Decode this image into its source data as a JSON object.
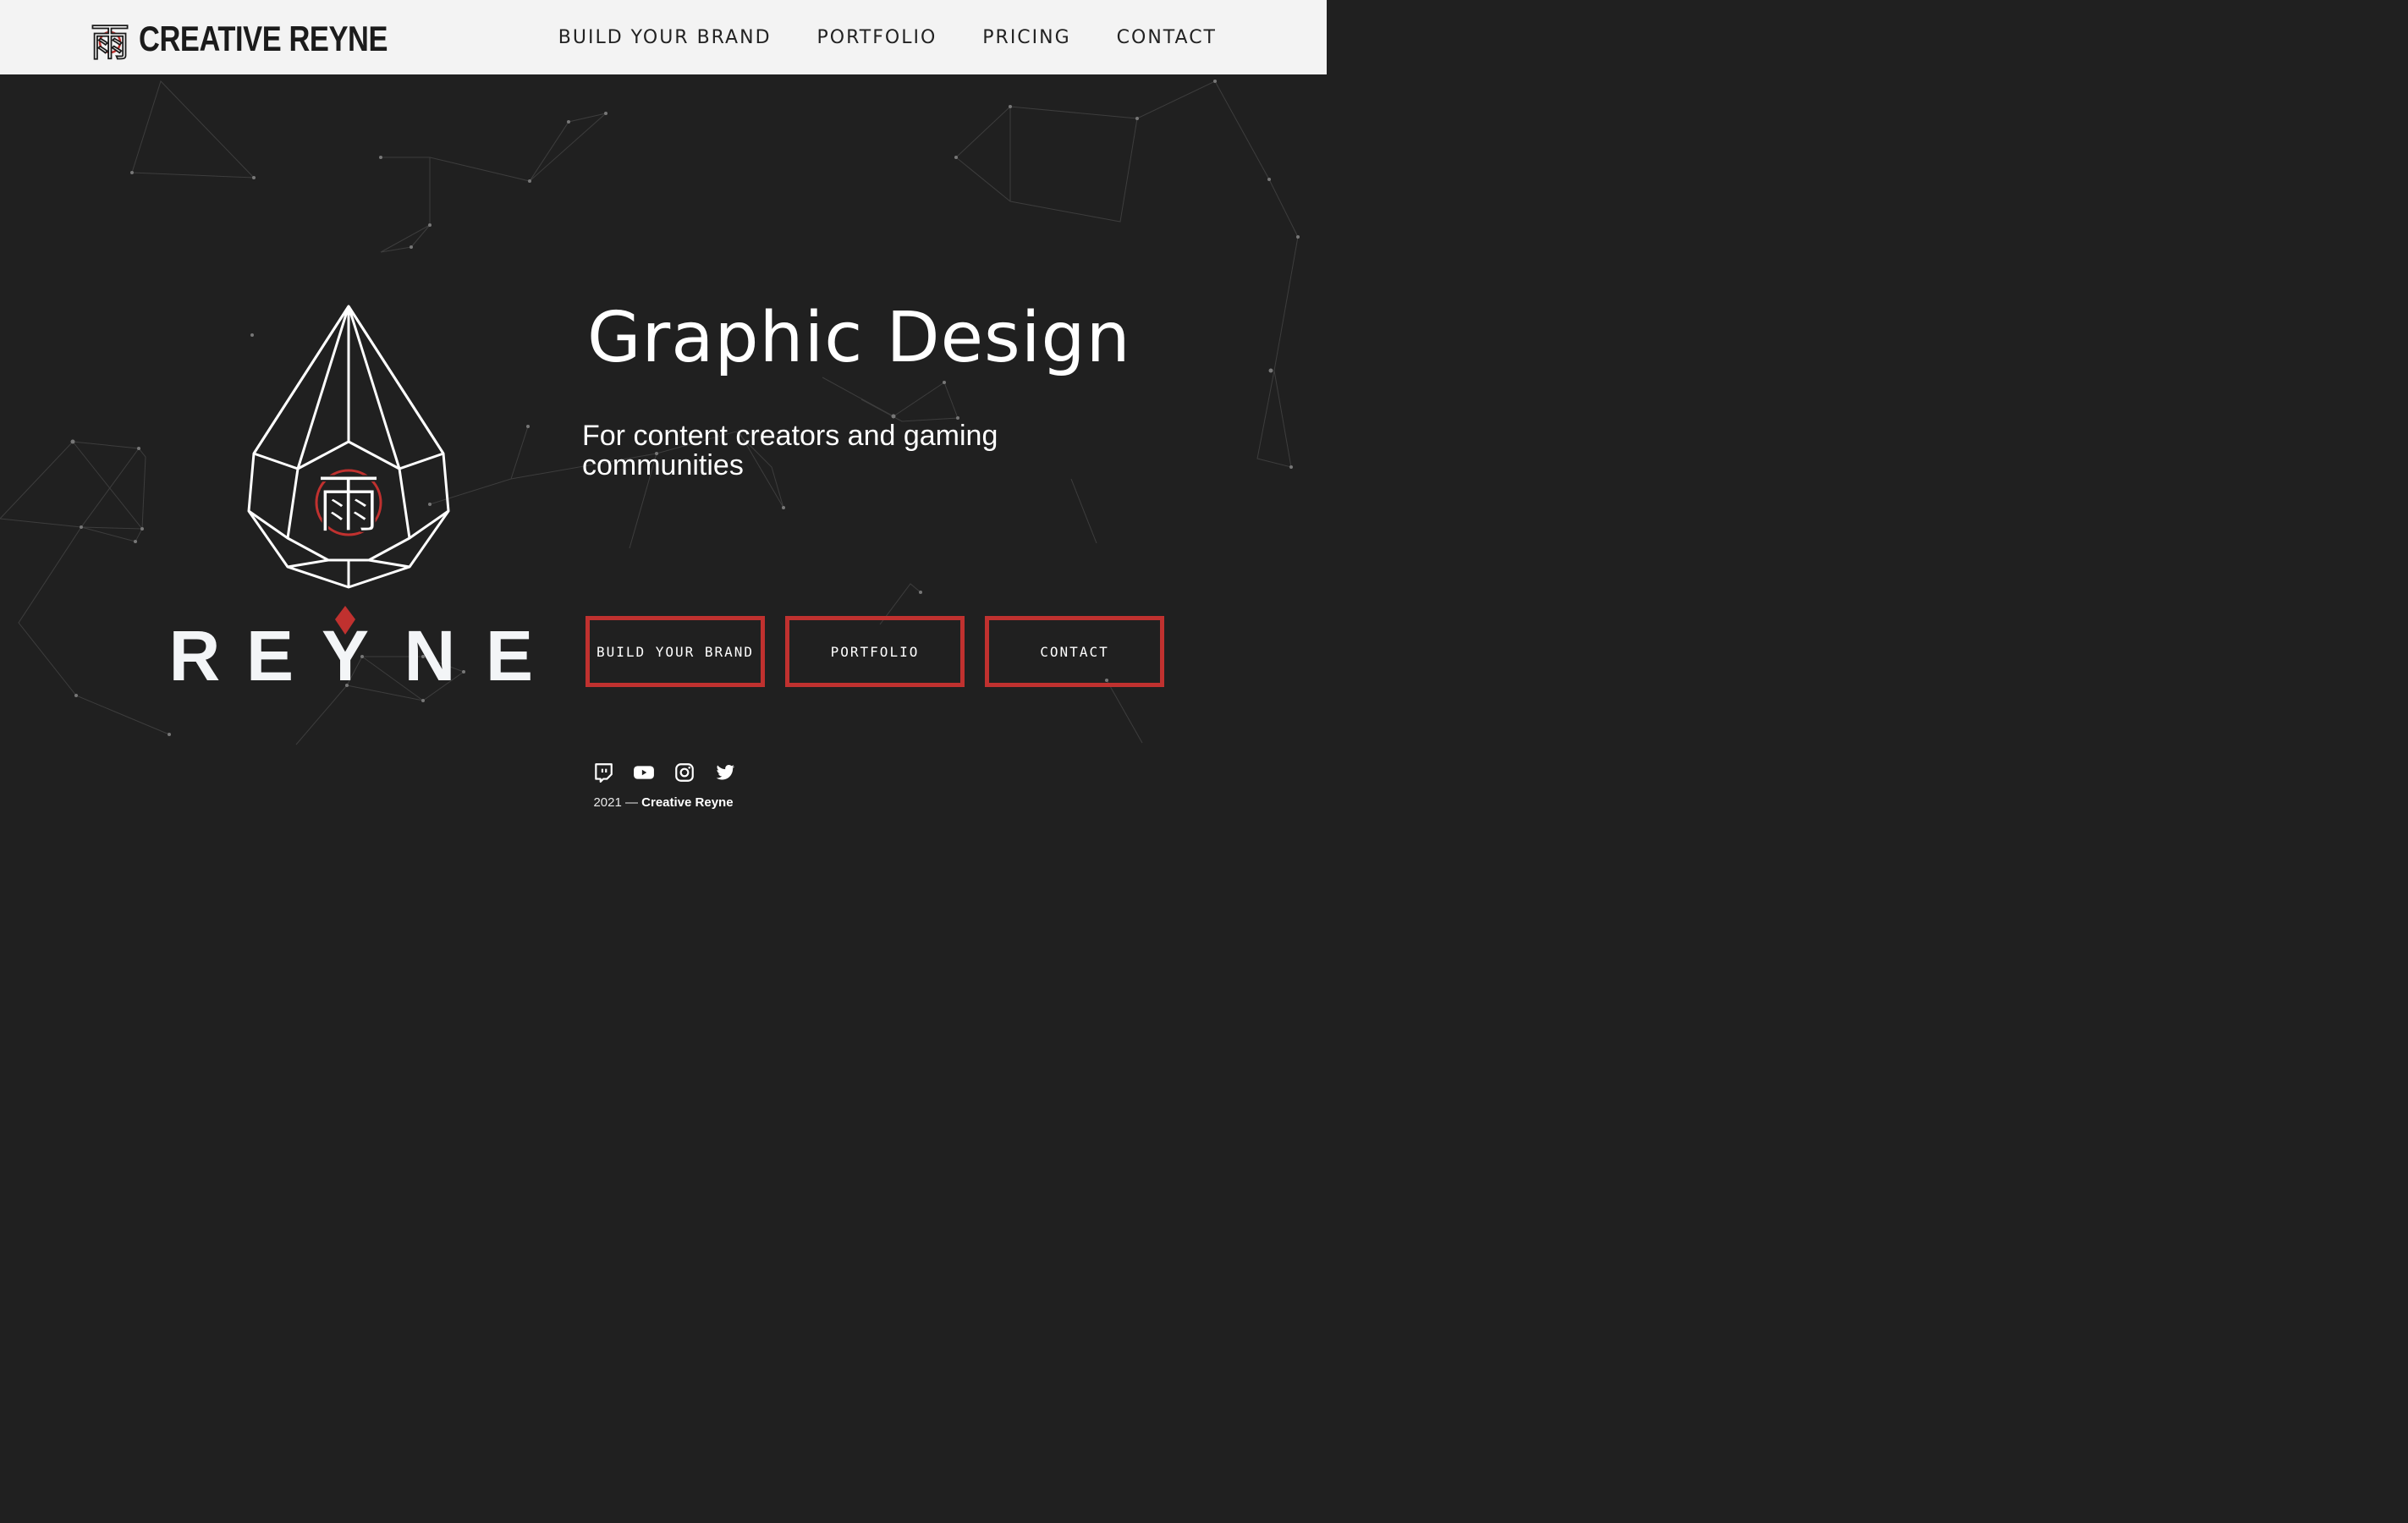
{
  "brand": {
    "name": "CREATIVE REYNE",
    "logo_icon": "rain-kanji-logo-icon",
    "glyph": "雨",
    "accent_color": "#c0312f"
  },
  "nav": {
    "items": [
      {
        "label": "BUILD YOUR BRAND"
      },
      {
        "label": "PORTFOLIO"
      },
      {
        "label": "PRICING"
      },
      {
        "label": "CONTACT"
      }
    ]
  },
  "hero": {
    "logo": {
      "kanji": "雨",
      "wordmark": "REYNE",
      "wordmark_letters": [
        "R",
        "E",
        "Y",
        "N",
        "E"
      ]
    },
    "title": "Graphic Design",
    "subtitle": "For content creators and gaming communities",
    "buttons": [
      {
        "label": "BUILD YOUR BRAND"
      },
      {
        "label": "PORTFOLIO"
      },
      {
        "label": "CONTACT"
      }
    ],
    "button_border_color": "#c0312f",
    "background_color": "#202020"
  },
  "footer": {
    "social": [
      "twitch-icon",
      "youtube-icon",
      "instagram-icon",
      "twitter-icon"
    ],
    "year": "2021",
    "separator": "—",
    "company": "Creative Reyne"
  }
}
